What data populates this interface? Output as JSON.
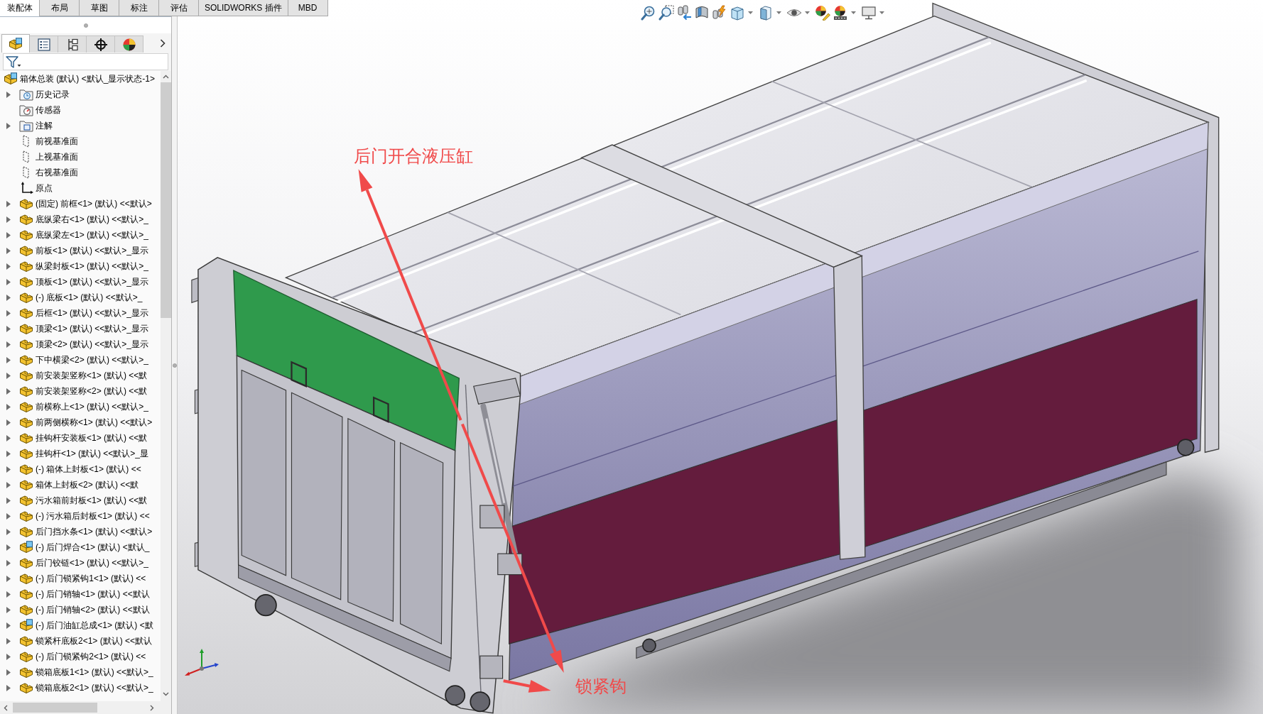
{
  "command_tabs": [
    {
      "label": "装配体",
      "selected": true
    },
    {
      "label": "布局",
      "selected": false
    },
    {
      "label": "草图",
      "selected": false
    },
    {
      "label": "标注",
      "selected": false
    },
    {
      "label": "评估",
      "selected": false
    },
    {
      "label": "SOLIDWORKS 插件",
      "selected": false
    },
    {
      "label": "MBD",
      "selected": false
    }
  ],
  "panel_tabs": [
    {
      "kind": "feature-tree",
      "selected": true
    },
    {
      "kind": "property",
      "selected": false
    },
    {
      "kind": "configuration",
      "selected": false
    },
    {
      "kind": "dimxpert",
      "selected": false
    },
    {
      "kind": "display",
      "selected": false
    }
  ],
  "feature_tree": {
    "label": "箱体总装 (默认) <默认_显示状态-1>",
    "kind": "assembly",
    "children": [
      {
        "label": "历史记录",
        "kind": "history",
        "expandable": true
      },
      {
        "label": "传感器",
        "kind": "sensor",
        "expandable": false
      },
      {
        "label": "注解",
        "kind": "annotation",
        "expandable": true
      },
      {
        "label": "前视基准面",
        "kind": "plane",
        "expandable": false
      },
      {
        "label": "上视基准面",
        "kind": "plane",
        "expandable": false
      },
      {
        "label": "右视基准面",
        "kind": "plane",
        "expandable": false
      },
      {
        "label": "原点",
        "kind": "origin",
        "expandable": false
      },
      {
        "label": "(固定) 前框<1> (默认) <<默认>",
        "kind": "part",
        "expandable": true
      },
      {
        "label": "底纵梁右<1> (默认) <<默认>_",
        "kind": "part",
        "expandable": true
      },
      {
        "label": "底纵梁左<1> (默认) <<默认>_",
        "kind": "part",
        "expandable": true
      },
      {
        "label": "前板<1> (默认) <<默认>_显示",
        "kind": "part",
        "expandable": true
      },
      {
        "label": "纵梁封板<1> (默认) <<默认>_",
        "kind": "part",
        "expandable": true
      },
      {
        "label": "顶板<1> (默认) <<默认>_显示",
        "kind": "part",
        "expandable": true
      },
      {
        "label": "(-) 底板<1> (默认) <<默认>_",
        "kind": "part",
        "expandable": true
      },
      {
        "label": "后框<1> (默认) <<默认>_显示",
        "kind": "part",
        "expandable": true
      },
      {
        "label": "顶梁<1> (默认) <<默认>_显示",
        "kind": "part",
        "expandable": true
      },
      {
        "label": "顶梁<2> (默认) <<默认>_显示",
        "kind": "part",
        "expandable": true
      },
      {
        "label": "下中横梁<2> (默认) <<默认>_",
        "kind": "part",
        "expandable": true
      },
      {
        "label": "前安装架竖称<1> (默认) <<默",
        "kind": "part",
        "expandable": true
      },
      {
        "label": "前安装架竖称<2> (默认) <<默",
        "kind": "part",
        "expandable": true
      },
      {
        "label": "前横称上<1> (默认) <<默认>_",
        "kind": "part",
        "expandable": true
      },
      {
        "label": "前两侧横称<1> (默认) <<默认>",
        "kind": "part",
        "expandable": true
      },
      {
        "label": "挂钩杆安装板<1> (默认) <<默",
        "kind": "part",
        "expandable": true
      },
      {
        "label": "挂钩杆<1> (默认) <<默认>_显",
        "kind": "part",
        "expandable": true
      },
      {
        "label": "(-) 箱体上封板<1> (默认) <<",
        "kind": "part",
        "expandable": true
      },
      {
        "label": "箱体上封板<2> (默认) <<默",
        "kind": "part",
        "expandable": true
      },
      {
        "label": "污水箱前封板<1> (默认) <<默",
        "kind": "part",
        "expandable": true
      },
      {
        "label": "(-) 污水箱后封板<1> (默认) <<",
        "kind": "part",
        "expandable": true
      },
      {
        "label": "后门挡水条<1> (默认) <<默认>",
        "kind": "part",
        "expandable": true
      },
      {
        "label": "(-) 后门焊合<1> (默认) <默认_",
        "kind": "subassembly",
        "expandable": true
      },
      {
        "label": "后门铰链<1> (默认) <<默认>_",
        "kind": "part",
        "expandable": true
      },
      {
        "label": "(-) 后门锁紧钩1<1> (默认) <<",
        "kind": "part",
        "expandable": true
      },
      {
        "label": "(-) 后门销轴<1> (默认) <<默认",
        "kind": "part",
        "expandable": true
      },
      {
        "label": "(-) 后门销轴<2> (默认) <<默认",
        "kind": "part",
        "expandable": true
      },
      {
        "label": "(-) 后门油缸总成<1> (默认) <默",
        "kind": "subassembly",
        "expandable": true
      },
      {
        "label": "锁紧杆底板2<1> (默认) <<默认",
        "kind": "part",
        "expandable": true
      },
      {
        "label": "(-) 后门锁紧钩2<1> (默认) <<",
        "kind": "part",
        "expandable": true
      },
      {
        "label": "锁箱底板1<1> (默认) <<默认>_",
        "kind": "part",
        "expandable": true
      },
      {
        "label": "锁箱底板2<1> (默认) <<默认>_",
        "kind": "part",
        "expandable": true
      }
    ]
  },
  "heads_up_toolbar": [
    {
      "kind": "zoom-fit",
      "dropdown": false
    },
    {
      "kind": "zoom-area",
      "dropdown": false
    },
    {
      "kind": "previous-view",
      "dropdown": false
    },
    {
      "kind": "section-view",
      "dropdown": false
    },
    {
      "kind": "dynamic-annotation",
      "dropdown": false
    },
    {
      "kind": "view-orientation",
      "dropdown": true
    },
    {
      "kind": "display-style",
      "dropdown": true
    },
    {
      "kind": "hide-show",
      "dropdown": true
    },
    {
      "kind": "edit-appearance",
      "dropdown": false
    },
    {
      "kind": "scene",
      "dropdown": true
    },
    {
      "kind": "view-settings",
      "dropdown": true
    }
  ],
  "callouts": [
    {
      "text": "后门开合液压缸"
    },
    {
      "text": "锁紧钩"
    }
  ]
}
